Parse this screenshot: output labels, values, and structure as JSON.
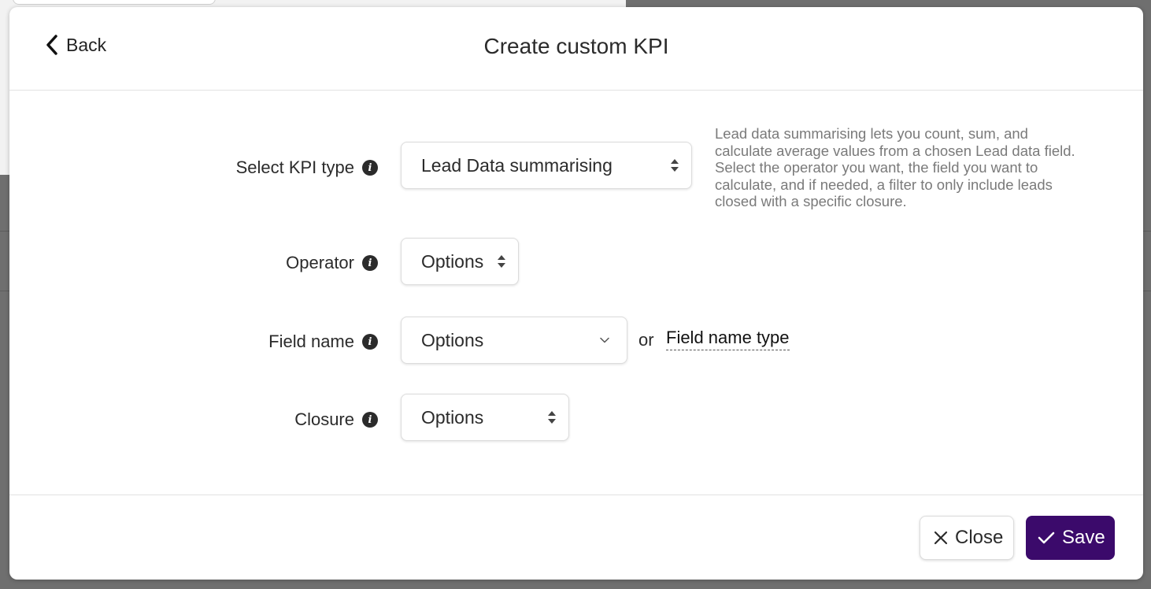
{
  "modal": {
    "title": "Create custom KPI",
    "back_label": "Back"
  },
  "form": {
    "kpi_type": {
      "label": "Select KPI type",
      "value": "Lead Data summarising"
    },
    "operator": {
      "label": "Operator",
      "value": "Options"
    },
    "field_name": {
      "label": "Field name",
      "value": "Options",
      "or_text": "or",
      "type_placeholder": "Field name type"
    },
    "closure": {
      "label": "Closure",
      "value": "Options"
    },
    "help_text": "Lead data summarising lets you count, sum, and calculate average values from a chosen Lead data field. Select the operator you want, the field you want to calculate, and if needed, a filter to only include leads closed with a specific closure."
  },
  "footer": {
    "close_label": "Close",
    "save_label": "Save"
  },
  "colors": {
    "primary": "#3b0a6b",
    "text": "#2b2b2b",
    "muted": "#7a7a7a"
  }
}
